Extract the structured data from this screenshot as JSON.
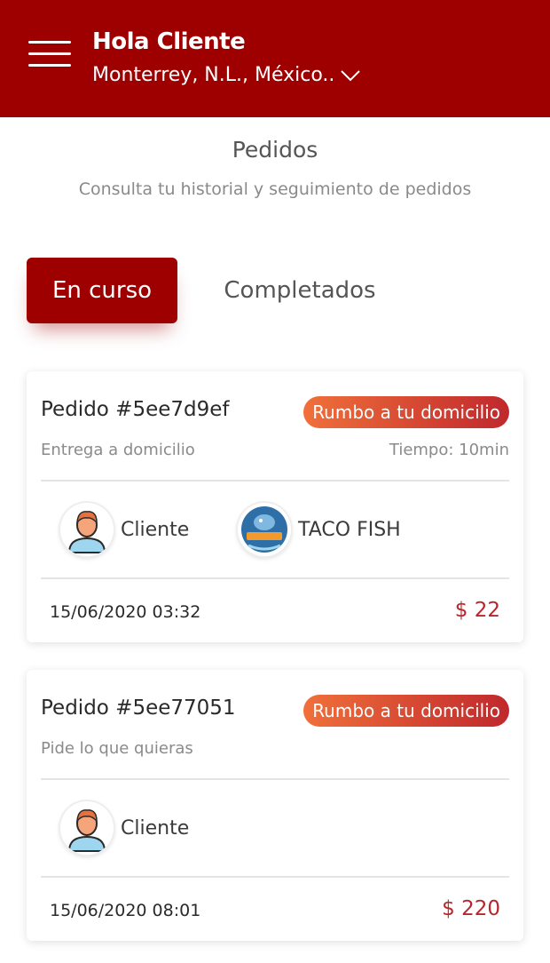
{
  "header": {
    "greeting": "Hola Cliente",
    "location": "Monterrey, N.L., México.."
  },
  "page": {
    "title": "Pedidos",
    "subtitle": "Consulta tu historial y seguimiento de pedidos"
  },
  "tabs": [
    {
      "label": "En curso",
      "active": true
    },
    {
      "label": "Completados",
      "active": false
    }
  ],
  "orders": [
    {
      "id": "Pedido #5ee7d9ef",
      "status": "Rumbo a tu domicilio",
      "type": "Entrega a domicilio",
      "time": "Tiempo: 10min",
      "customer": "Cliente",
      "restaurant": "TACO FISH",
      "date": "15/06/2020 03:32",
      "price": "$ 22"
    },
    {
      "id": "Pedido #5ee77051",
      "status": "Rumbo a tu domicilio",
      "type": "Pide lo que quieras",
      "customer": "Cliente",
      "date": "15/06/2020 08:01",
      "price": "$ 220"
    }
  ],
  "colors": {
    "brand": "#9e0000",
    "badge_start": "#f0703a",
    "badge_end": "#c0282d",
    "price": "#b8262c"
  },
  "icons": {
    "menu": "hamburger-menu-icon",
    "location_dropdown": "chevron-down-icon",
    "customer_avatar": "user-avatar-icon",
    "restaurant_logo": "taco-fish-logo"
  }
}
